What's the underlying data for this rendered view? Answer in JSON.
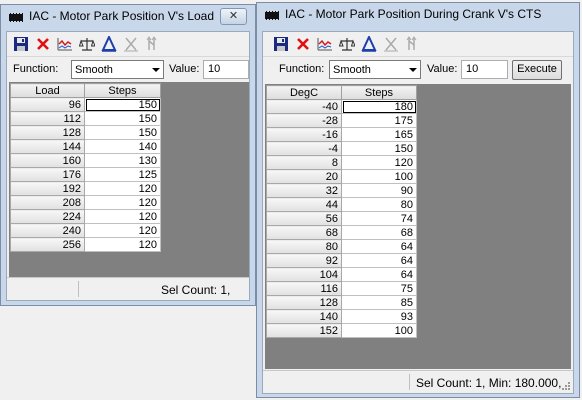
{
  "windows": [
    {
      "title": "IAC - Motor Park Position V's Load",
      "close_label": "✕",
      "function_label": "Function:",
      "function_value": "Smooth",
      "value_label": "Value:",
      "value": "10",
      "columns": [
        "Load",
        "Steps"
      ],
      "rows": [
        [
          "96",
          "150"
        ],
        [
          "112",
          "150"
        ],
        [
          "128",
          "150"
        ],
        [
          "144",
          "140"
        ],
        [
          "160",
          "130"
        ],
        [
          "176",
          "125"
        ],
        [
          "192",
          "120"
        ],
        [
          "208",
          "120"
        ],
        [
          "224",
          "120"
        ],
        [
          "240",
          "120"
        ],
        [
          "256",
          "120"
        ]
      ],
      "status": "Sel Count: 1,"
    },
    {
      "title": "IAC - Motor Park Position During Crank V's CTS",
      "function_label": "Function:",
      "function_value": "Smooth",
      "value_label": "Value:",
      "value": "10",
      "execute_label": "Execute",
      "columns": [
        "DegC",
        "Steps"
      ],
      "rows": [
        [
          "-40",
          "180"
        ],
        [
          "-28",
          "175"
        ],
        [
          "-16",
          "165"
        ],
        [
          "-4",
          "150"
        ],
        [
          "8",
          "120"
        ],
        [
          "20",
          "100"
        ],
        [
          "32",
          "90"
        ],
        [
          "44",
          "80"
        ],
        [
          "56",
          "74"
        ],
        [
          "68",
          "68"
        ],
        [
          "80",
          "64"
        ],
        [
          "92",
          "64"
        ],
        [
          "104",
          "64"
        ],
        [
          "116",
          "75"
        ],
        [
          "128",
          "85"
        ],
        [
          "140",
          "93"
        ],
        [
          "152",
          "100"
        ]
      ],
      "status": "Sel Count: 1, Min: 180.000,"
    }
  ],
  "toolbar_icons": [
    "save-icon",
    "delete-icon",
    "graph-icon",
    "scale-icon",
    "interpolate-icon",
    "clear-icon",
    "tools-icon"
  ],
  "colors": {
    "frame": "#c8d8ea",
    "grid_background": "#808080",
    "delete_red": "#e01010",
    "icon_blue": "#1c3fae"
  }
}
